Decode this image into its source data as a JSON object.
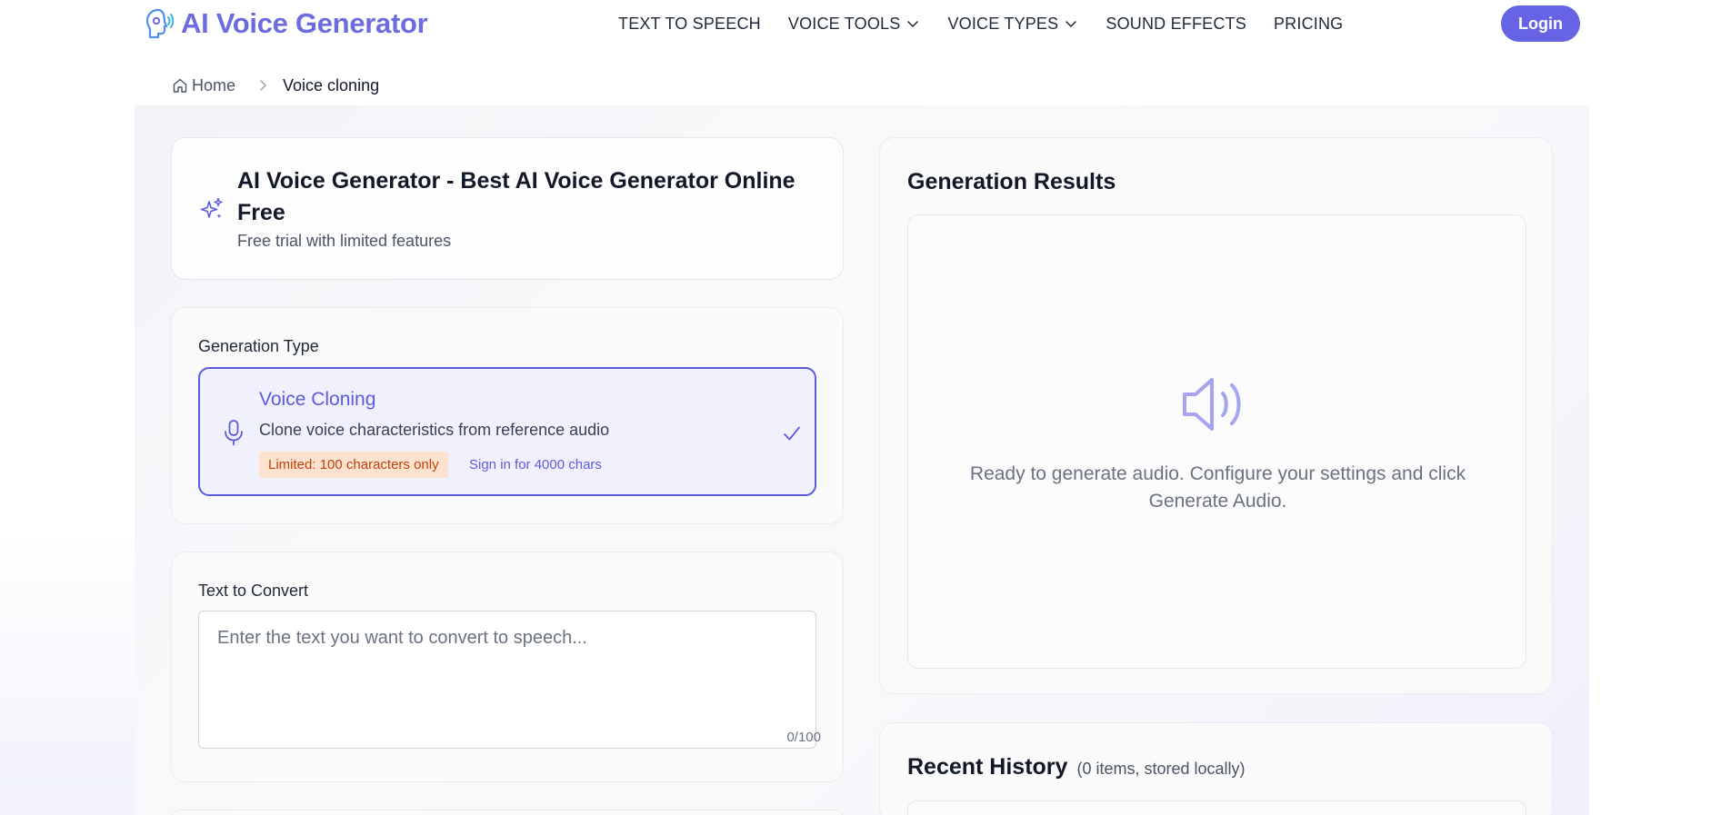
{
  "header": {
    "logo_text": "AI Voice Generator",
    "nav": [
      {
        "label": "TEXT TO SPEECH",
        "dropdown": false
      },
      {
        "label": "VOICE TOOLS",
        "dropdown": true
      },
      {
        "label": "VOICE TYPES",
        "dropdown": true
      },
      {
        "label": "SOUND EFFECTS",
        "dropdown": false
      },
      {
        "label": "PRICING",
        "dropdown": false
      }
    ],
    "login_label": "Login"
  },
  "breadcrumb": {
    "home": "Home",
    "current": "Voice cloning"
  },
  "title_card": {
    "title": "AI Voice Generator - Best AI Voice Generator Online Free",
    "subtitle": "Free trial with limited features"
  },
  "generation": {
    "label": "Generation Type",
    "option": {
      "title": "Voice Cloning",
      "description": "Clone voice characteristics from reference audio",
      "limit_badge": "Limited: 100 characters only",
      "signin_link": "Sign in for 4000 chars",
      "selected": true
    }
  },
  "text_input": {
    "label": "Text to Convert",
    "placeholder": "Enter the text you want to convert to speech...",
    "value": "",
    "char_count": "0/100"
  },
  "results": {
    "title": "Generation Results",
    "empty_message": "Ready to generate audio. Configure your settings and click Generate Audio."
  },
  "history": {
    "title": "Recent History",
    "subtitle": "(0 items, stored locally)"
  },
  "colors": {
    "accent": "#6663e4",
    "badge_bg": "#fde3cf",
    "badge_text": "#c2410c"
  },
  "icons": {
    "logo": "head-sound-icon",
    "home": "home-icon",
    "sparkle": "sparkles-icon",
    "mic": "microphone-icon",
    "check": "check-icon",
    "speaker": "speaker-icon"
  }
}
